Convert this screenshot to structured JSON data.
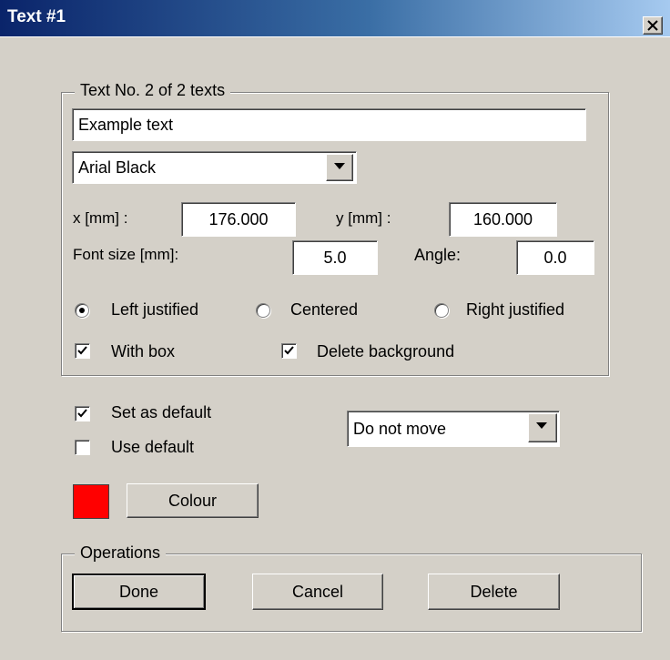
{
  "window": {
    "title": "Text #1"
  },
  "text_group": {
    "legend": "Text  No. 2 of  2 texts",
    "text_value": "Example text",
    "font_value": "Arial Black",
    "x_label": "x [mm] :",
    "x_value": "176.000",
    "y_label": "y [mm] :",
    "y_value": "160.000",
    "font_size_label": "Font size [mm]:",
    "font_size_value": "5.0",
    "angle_label": "Angle:",
    "angle_value": "0.0",
    "alignment": {
      "left_label": "Left justified",
      "center_label": "Centered",
      "right_label": "Right justified",
      "selected": "left"
    },
    "with_box_label": "With box",
    "with_box_checked": true,
    "delete_bg_label": "Delete background",
    "delete_bg_checked": true
  },
  "defaults": {
    "set_default_label": "Set as default",
    "set_default_checked": true,
    "use_default_label": "Use default",
    "use_default_checked": false,
    "move_value": "Do not move"
  },
  "colour": {
    "button_label": "Colour",
    "swatch": "#ff0000"
  },
  "operations": {
    "legend": "Operations",
    "done_label": "Done",
    "cancel_label": "Cancel",
    "delete_label": "Delete"
  },
  "icons": {
    "close": "close-icon",
    "dropdown": "chevron-down-icon",
    "check": "checkmark-icon"
  }
}
